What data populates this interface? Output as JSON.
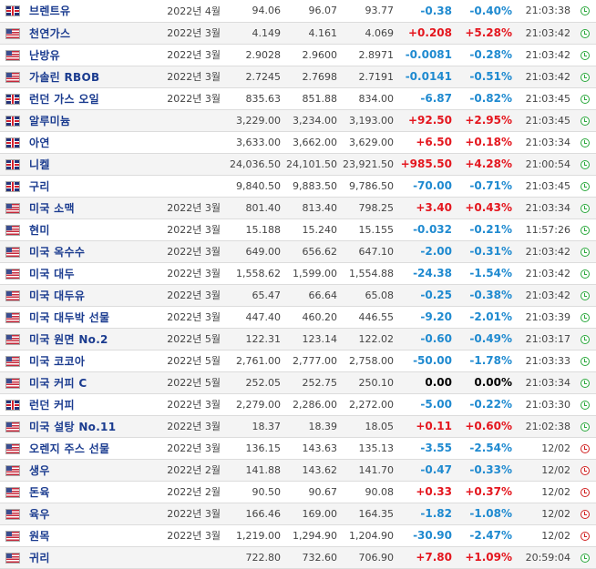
{
  "rows": [
    {
      "flag": "uk",
      "name": "브렌트유",
      "month": "2022년 4월",
      "last": "94.06",
      "high": "96.07",
      "low": "93.77",
      "change": "-0.38",
      "pct": "-0.40%",
      "time": "21:03:38",
      "status": "open"
    },
    {
      "flag": "us",
      "name": "천연가스",
      "month": "2022년 3월",
      "last": "4.149",
      "high": "4.161",
      "low": "4.069",
      "change": "+0.208",
      "pct": "+5.28%",
      "time": "21:03:42",
      "status": "open"
    },
    {
      "flag": "us",
      "name": "난방유",
      "month": "2022년 3월",
      "last": "2.9028",
      "high": "2.9600",
      "low": "2.8971",
      "change": "-0.0081",
      "pct": "-0.28%",
      "time": "21:03:42",
      "status": "open"
    },
    {
      "flag": "us",
      "name": "가솔린 RBOB",
      "month": "2022년 3월",
      "last": "2.7245",
      "high": "2.7698",
      "low": "2.7191",
      "change": "-0.0141",
      "pct": "-0.51%",
      "time": "21:03:42",
      "status": "open"
    },
    {
      "flag": "uk",
      "name": "런던 가스 오일",
      "month": "2022년 3월",
      "last": "835.63",
      "high": "851.88",
      "low": "834.00",
      "change": "-6.87",
      "pct": "-0.82%",
      "time": "21:03:45",
      "status": "open"
    },
    {
      "flag": "uk",
      "name": "알루미늄",
      "month": "",
      "last": "3,229.00",
      "high": "3,234.00",
      "low": "3,193.00",
      "change": "+92.50",
      "pct": "+2.95%",
      "time": "21:03:45",
      "status": "open"
    },
    {
      "flag": "uk",
      "name": "아연",
      "month": "",
      "last": "3,633.00",
      "high": "3,662.00",
      "low": "3,629.00",
      "change": "+6.50",
      "pct": "+0.18%",
      "time": "21:03:34",
      "status": "open"
    },
    {
      "flag": "uk",
      "name": "니켈",
      "month": "",
      "last": "24,036.50",
      "high": "24,101.50",
      "low": "23,921.50",
      "change": "+985.50",
      "pct": "+4.28%",
      "time": "21:00:54",
      "status": "open"
    },
    {
      "flag": "uk",
      "name": "구리",
      "month": "",
      "last": "9,840.50",
      "high": "9,883.50",
      "low": "9,786.50",
      "change": "-70.00",
      "pct": "-0.71%",
      "time": "21:03:45",
      "status": "open"
    },
    {
      "flag": "us",
      "name": "미국 소맥",
      "month": "2022년 3월",
      "last": "801.40",
      "high": "813.40",
      "low": "798.25",
      "change": "+3.40",
      "pct": "+0.43%",
      "time": "21:03:34",
      "status": "open"
    },
    {
      "flag": "us",
      "name": "현미",
      "month": "2022년 3월",
      "last": "15.188",
      "high": "15.240",
      "low": "15.155",
      "change": "-0.032",
      "pct": "-0.21%",
      "time": "11:57:26",
      "status": "open"
    },
    {
      "flag": "us",
      "name": "미국 옥수수",
      "month": "2022년 3월",
      "last": "649.00",
      "high": "656.62",
      "low": "647.10",
      "change": "-2.00",
      "pct": "-0.31%",
      "time": "21:03:42",
      "status": "open"
    },
    {
      "flag": "us",
      "name": "미국 대두",
      "month": "2022년 3월",
      "last": "1,558.62",
      "high": "1,599.00",
      "low": "1,554.88",
      "change": "-24.38",
      "pct": "-1.54%",
      "time": "21:03:42",
      "status": "open"
    },
    {
      "flag": "us",
      "name": "미국 대두유",
      "month": "2022년 3월",
      "last": "65.47",
      "high": "66.64",
      "low": "65.08",
      "change": "-0.25",
      "pct": "-0.38%",
      "time": "21:03:42",
      "status": "open"
    },
    {
      "flag": "us",
      "name": "미국 대두박 선물",
      "month": "2022년 3월",
      "last": "447.40",
      "high": "460.20",
      "low": "446.55",
      "change": "-9.20",
      "pct": "-2.01%",
      "time": "21:03:39",
      "status": "open"
    },
    {
      "flag": "us",
      "name": "미국 원면 No.2",
      "month": "2022년 5월",
      "last": "122.31",
      "high": "123.14",
      "low": "122.02",
      "change": "-0.60",
      "pct": "-0.49%",
      "time": "21:03:17",
      "status": "open"
    },
    {
      "flag": "us",
      "name": "미국 코코아",
      "month": "2022년 5월",
      "last": "2,761.00",
      "high": "2,777.00",
      "low": "2,758.00",
      "change": "-50.00",
      "pct": "-1.78%",
      "time": "21:03:33",
      "status": "open"
    },
    {
      "flag": "us",
      "name": "미국 커피 C",
      "month": "2022년 5월",
      "last": "252.05",
      "high": "252.75",
      "low": "250.10",
      "change": "0.00",
      "pct": "0.00%",
      "time": "21:03:34",
      "status": "open"
    },
    {
      "flag": "uk",
      "name": "런던 커피",
      "month": "2022년 3월",
      "last": "2,279.00",
      "high": "2,286.00",
      "low": "2,272.00",
      "change": "-5.00",
      "pct": "-0.22%",
      "time": "21:03:30",
      "status": "open"
    },
    {
      "flag": "us",
      "name": "미국 설탕 No.11",
      "month": "2022년 3월",
      "last": "18.37",
      "high": "18.39",
      "low": "18.05",
      "change": "+0.11",
      "pct": "+0.60%",
      "time": "21:02:38",
      "status": "open"
    },
    {
      "flag": "us",
      "name": "오렌지 주스 선물",
      "month": "2022년 3월",
      "last": "136.15",
      "high": "143.63",
      "low": "135.13",
      "change": "-3.55",
      "pct": "-2.54%",
      "time": "12/02",
      "status": "closed"
    },
    {
      "flag": "us",
      "name": "생우",
      "month": "2022년 2월",
      "last": "141.88",
      "high": "143.62",
      "low": "141.70",
      "change": "-0.47",
      "pct": "-0.33%",
      "time": "12/02",
      "status": "closed"
    },
    {
      "flag": "us",
      "name": "돈육",
      "month": "2022년 2월",
      "last": "90.50",
      "high": "90.67",
      "low": "90.08",
      "change": "+0.33",
      "pct": "+0.37%",
      "time": "12/02",
      "status": "closed"
    },
    {
      "flag": "us",
      "name": "육우",
      "month": "2022년 3월",
      "last": "166.46",
      "high": "169.00",
      "low": "164.35",
      "change": "-1.82",
      "pct": "-1.08%",
      "time": "12/02",
      "status": "closed"
    },
    {
      "flag": "us",
      "name": "원목",
      "month": "2022년 3월",
      "last": "1,219.00",
      "high": "1,294.90",
      "low": "1,204.90",
      "change": "-30.90",
      "pct": "-2.47%",
      "time": "12/02",
      "status": "closed"
    },
    {
      "flag": "us",
      "name": "귀리",
      "month": "",
      "last": "722.80",
      "high": "732.60",
      "low": "706.90",
      "change": "+7.80",
      "pct": "+1.09%",
      "time": "20:59:04",
      "status": "open"
    }
  ],
  "colors": {
    "positive": "#e4161e",
    "negative": "#1f8ad0",
    "neutral": "#000000",
    "name": "#1a3b8f",
    "clock_open": "#2aa83c",
    "clock_closed": "#d02020"
  },
  "icons": {
    "us": "us-flag-icon",
    "uk": "uk-flag-icon",
    "open": "clock-open-icon",
    "closed": "clock-closed-icon"
  }
}
